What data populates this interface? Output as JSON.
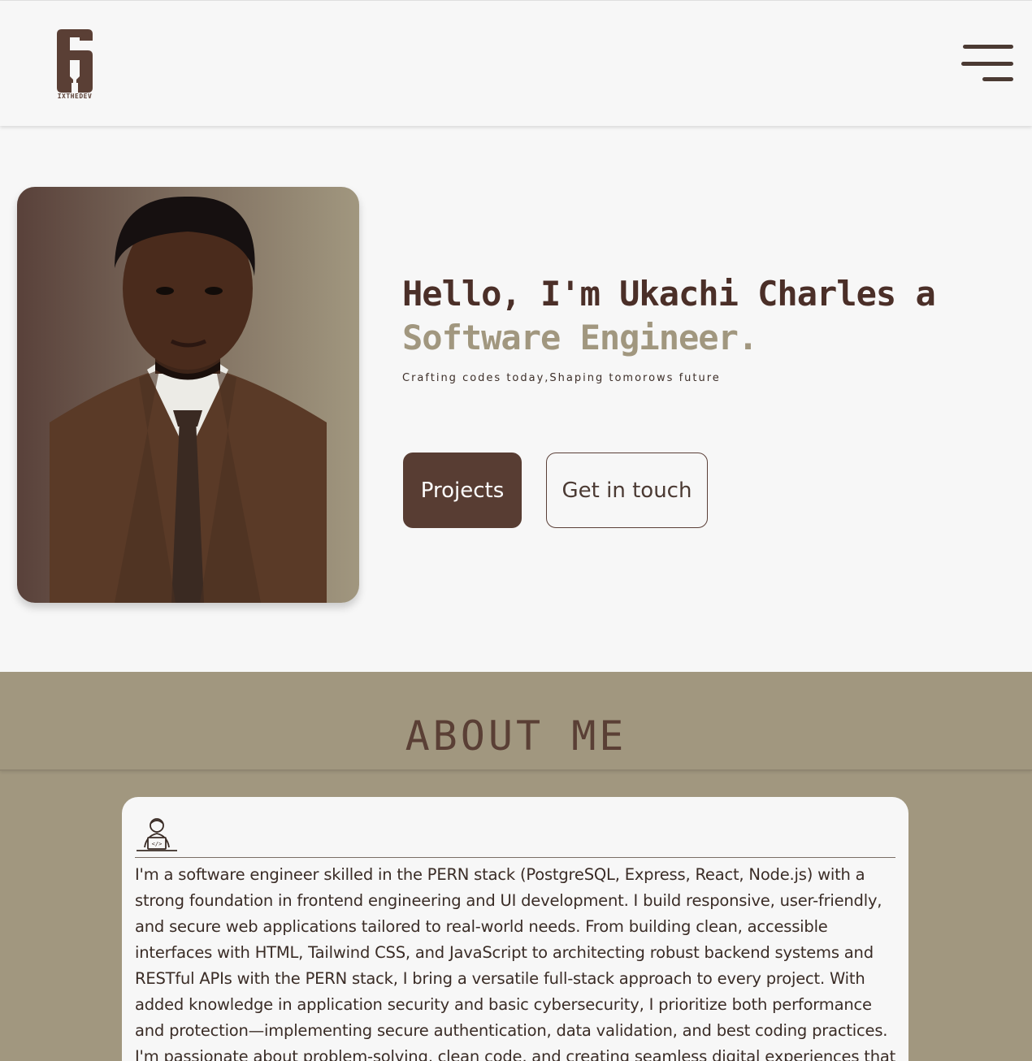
{
  "brand": {
    "logo_text": "IXTHEDEV",
    "logo_icon": "six-logo-icon"
  },
  "nav": {
    "menu_icon": "hamburger-menu-icon"
  },
  "hero": {
    "greeting": "Hello, I'm Ukachi Charles a ",
    "role": "Software Engineer.",
    "tagline": "Crafting codes today,Shaping tomorows future",
    "projects_label": "Projects",
    "contact_label": "Get in touch",
    "photo": "profile-photo"
  },
  "about": {
    "title": "ABOUT ME",
    "icon": "developer-laptop-icon",
    "body": "I'm a software engineer skilled in the PERN stack (PostgreSQL, Express, React, Node.js) with a strong foundation in frontend engineering and UI development. I build responsive, user-friendly, and secure web applications tailored to real-world needs. From building clean, accessible interfaces with HTML, Tailwind CSS, and JavaScript to architecting robust backend systems and RESTful APIs with the PERN stack, I bring a versatile full-stack approach to every project. With added knowledge in application security and basic cybersecurity, I prioritize both performance and protection—implementing secure authentication, data validation, and best coding practices. I'm passionate about problem-solving, clean code, and creating seamless digital experiences that leave"
  },
  "colors": {
    "primary": "#583d33",
    "accent": "#a1977f",
    "background": "#f7f7f7"
  }
}
